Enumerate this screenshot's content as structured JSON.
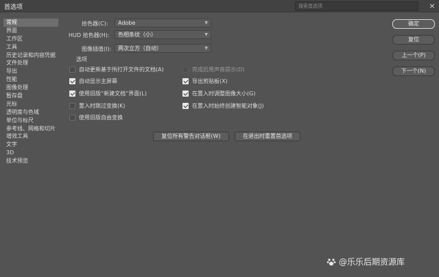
{
  "window": {
    "title": "首选项",
    "search_placeholder": "搜索首选项",
    "close_glyph": "×"
  },
  "sidebar": {
    "items": [
      {
        "label": "常规",
        "active": true
      },
      {
        "label": "界面"
      },
      {
        "label": "工作区"
      },
      {
        "label": "工具"
      },
      {
        "label": "历史记录和内容凭据"
      },
      {
        "label": "文件处理"
      },
      {
        "label": "导出"
      },
      {
        "label": "性能"
      },
      {
        "label": "图像处理"
      },
      {
        "label": "暂存盘"
      },
      {
        "label": "光标"
      },
      {
        "label": "透明度与色域"
      },
      {
        "label": "单位与标尺"
      },
      {
        "label": "参考线、网格和切片"
      },
      {
        "label": "增效工具"
      },
      {
        "label": "文字"
      },
      {
        "label": "3D"
      },
      {
        "label": "技术预览"
      }
    ]
  },
  "settings": {
    "color_picker": {
      "label": "拾色器(C):",
      "value": "Adobe"
    },
    "hud_color_picker": {
      "label": "HUD 拾色器(H):",
      "value": "色相条纹（小）"
    },
    "image_interpolation": {
      "label": "图像插值(I):",
      "value": "两次立方（自动）"
    }
  },
  "options": {
    "section_label": "选项",
    "left": [
      {
        "label": "自动更新基于所打开文件的文档(A)",
        "checked": false,
        "disabled": false
      },
      {
        "label": "自动显示主屏幕",
        "checked": true,
        "disabled": false
      },
      {
        "label": "使用旧版“新建文档”界面(L)",
        "checked": true,
        "disabled": false
      },
      {
        "label": "置入时跳过变换(K)",
        "checked": false,
        "disabled": false
      },
      {
        "label": "使用旧版自由变换",
        "checked": false,
        "disabled": false
      }
    ],
    "right": [
      {
        "label": "完成后用声音提示(D)",
        "checked": false,
        "disabled": true
      },
      {
        "label": "导出剪贴板(X)",
        "checked": true,
        "disabled": false
      },
      {
        "label": "在置入时调整图像大小(G)",
        "checked": true,
        "disabled": false
      },
      {
        "label": "在置入时始终创建智能对象(J)",
        "checked": true,
        "disabled": false
      }
    ]
  },
  "actions": {
    "reset_warnings": "复位所有警告对话框(W)",
    "reset_on_quit": "在退出时重置首选项",
    "ok": "确定",
    "reset": "复位",
    "prev": "上一个(P)",
    "next": "下一个(N)"
  },
  "watermark": "@乐乐后期资源库",
  "colors": {
    "background": "#535353",
    "titlebar": "#424242",
    "text": "#dcdcdc",
    "active_item": "#6e6e6e"
  }
}
